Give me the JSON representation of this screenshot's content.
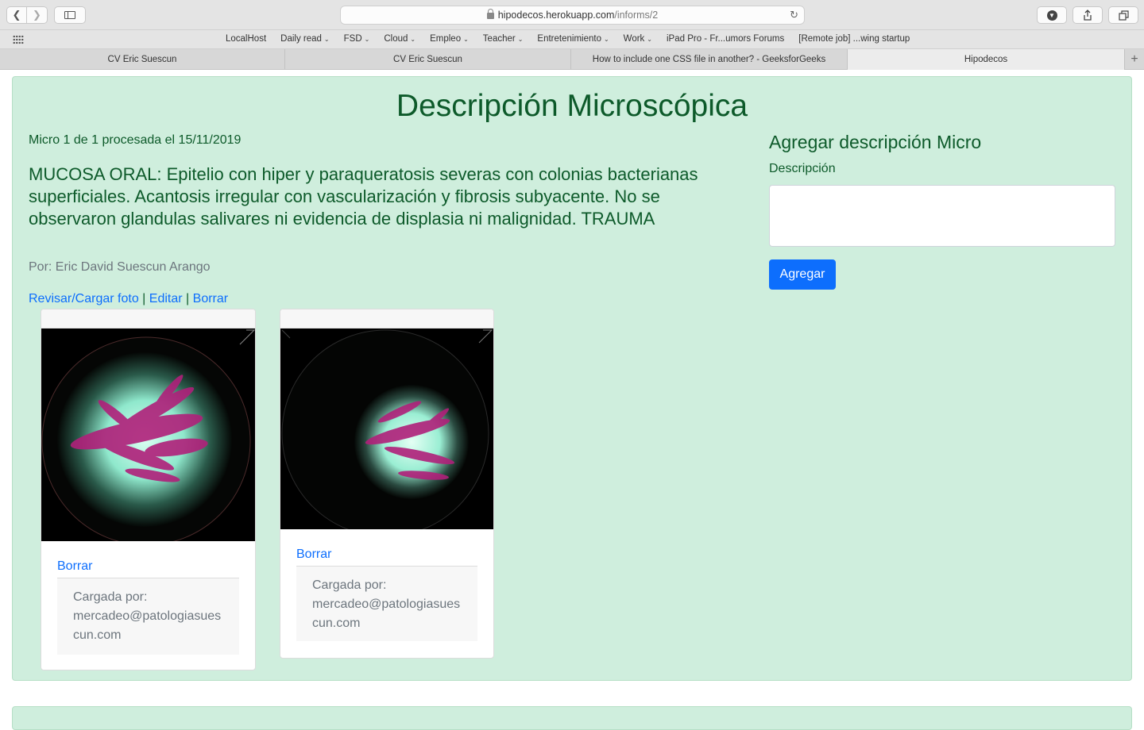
{
  "browser": {
    "url_host": "hipodecos.herokuapp.com",
    "url_path": "/informs/2",
    "favorites": [
      {
        "label": "LocalHost",
        "menu": false
      },
      {
        "label": "Daily read",
        "menu": true
      },
      {
        "label": "FSD",
        "menu": true
      },
      {
        "label": "Cloud",
        "menu": true
      },
      {
        "label": "Empleo",
        "menu": true
      },
      {
        "label": "Teacher",
        "menu": true
      },
      {
        "label": "Entretenimiento",
        "menu": true
      },
      {
        "label": "Work",
        "menu": true
      },
      {
        "label": "iPad Pro - Fr...umors Forums",
        "menu": false
      },
      {
        "label": "[Remote job] ...wing startup",
        "menu": false
      }
    ],
    "tabs": [
      {
        "label": "CV Eric Suescun",
        "active": false
      },
      {
        "label": "CV Eric Suescun",
        "active": false
      },
      {
        "label": "How to include one CSS file in another? - GeeksforGeeks",
        "active": false
      },
      {
        "label": "Hipodecos",
        "active": true
      }
    ]
  },
  "page": {
    "title": "Descripción Microscópica",
    "meta": "Micro 1 de 1 procesada el 15/11/2019",
    "description": "MUCOSA ORAL: Epitelio con hiper y paraqueratosis severas con colonias bacterianas superficiales. Acantosis irregular con vascularización y fibrosis subyacente. No se observaron glandulas salivares ni evidencia de displasia ni malignidad. TRAUMA",
    "author": "Por: Eric David Suescun Arango",
    "actions": {
      "review": "Revisar/Cargar foto",
      "separator": "|",
      "edit": "Editar",
      "delete": "Borrar"
    },
    "photos": [
      {
        "delete_label": "Borrar",
        "uploaded_by_label": "Cargada por:",
        "uploaded_by": "mercadeo@patologiasuescun.com"
      },
      {
        "delete_label": "Borrar",
        "uploaded_by_label": "Cargada por:",
        "uploaded_by": "mercadeo@patologiasuescun.com"
      }
    ]
  },
  "form": {
    "title": "Agregar descripción Micro",
    "label": "Descripción",
    "textarea_value": "",
    "submit": "Agregar"
  },
  "colors": {
    "panel_bg": "#cfeedd",
    "heading_green": "#0d5a2a",
    "link_blue": "#0d6efd",
    "stain_magenta": "#b0207a",
    "stain_cyan": "#7fe3c8"
  }
}
